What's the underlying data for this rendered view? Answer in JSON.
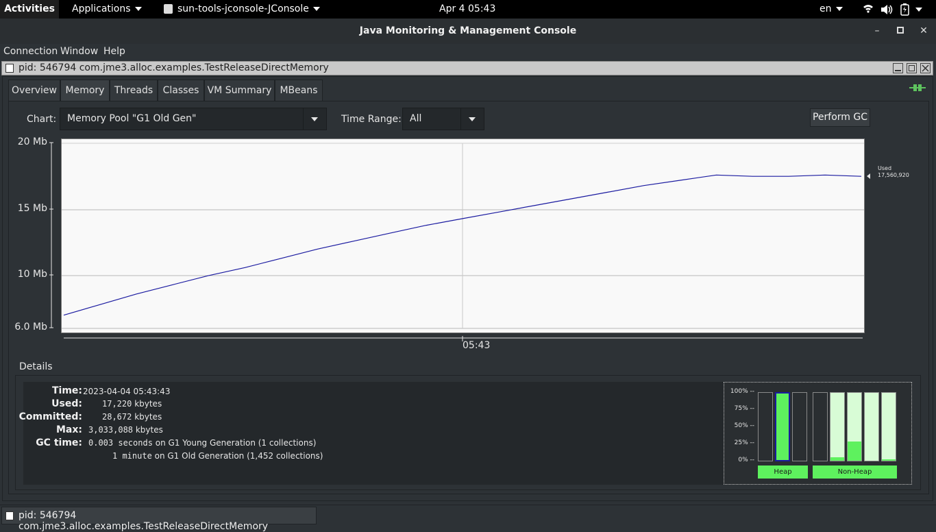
{
  "topbar": {
    "activities": "Activities",
    "applications": "Applications",
    "app_name": "sun-tools-jconsole-JConsole",
    "clock": "Apr 4  05:43",
    "lang": "en"
  },
  "window": {
    "title": "Java Monitoring & Management Console",
    "minimize": "–",
    "maximize": "▫",
    "close": "✕"
  },
  "menu": {
    "connection": "Connection",
    "window": "Window",
    "help": "Help"
  },
  "frame": {
    "title": "pid: 546794 com.jme3.alloc.examples.TestReleaseDirectMemory"
  },
  "tabs": [
    {
      "label": "Overview"
    },
    {
      "label": "Memory"
    },
    {
      "label": "Threads"
    },
    {
      "label": "Classes"
    },
    {
      "label": "VM Summary"
    },
    {
      "label": "MBeans"
    }
  ],
  "controls": {
    "chart_label": "Chart:",
    "chart_value": "Memory Pool \"G1 Old Gen\"",
    "time_range_label": "Time Range:",
    "time_range_value": "All",
    "perform_gc": "Perform GC"
  },
  "chart_data": {
    "type": "line",
    "y_ticks": [
      "20 Mb",
      "15 Mb",
      "10 Mb",
      "6.0 Mb"
    ],
    "x_ticks": [
      "05:43"
    ],
    "ylim": [
      6.0,
      20
    ],
    "grid": true,
    "series": [
      {
        "name": "Used",
        "color": "#1a1aa0",
        "x": [
          0,
          1,
          2,
          3,
          4,
          5,
          6,
          7,
          8,
          9,
          10,
          11,
          12,
          13,
          14,
          15,
          16,
          17,
          18,
          19,
          20,
          21,
          22
        ],
        "y": [
          7.0,
          7.8,
          8.6,
          9.3,
          10.0,
          10.6,
          11.3,
          12.0,
          12.6,
          13.2,
          13.8,
          14.3,
          14.8,
          15.3,
          15.8,
          16.3,
          16.8,
          17.2,
          17.6,
          17.5,
          17.5,
          17.6,
          17.5
        ]
      }
    ],
    "end_label": "Used",
    "end_value": "17,560,920"
  },
  "details": {
    "legend": "Details",
    "time_label": "Time:",
    "time_value": "2023-04-04 05:43:43",
    "used_label": "Used:",
    "used_value": "17,220",
    "used_unit": "kbytes",
    "committed_label": "Committed:",
    "committed_value": "28,672",
    "committed_unit": "kbytes",
    "max_label": "Max:",
    "max_value": "3,033,088",
    "max_unit": "kbytes",
    "gc_label": "GC time:",
    "gc1_value": "0.003 seconds",
    "gc1_desc": "on G1 Young Generation (1 collections)",
    "gc2_value": "1 minute",
    "gc2_desc": "on G1 Old Generation (1,452 collections)"
  },
  "bars": {
    "pct_labels": [
      "100% --",
      "75% --",
      "50% --",
      "25% --",
      "0% --"
    ],
    "heap_label": "Heap",
    "nonheap_label": "Non-Heap",
    "heap_levels": [
      0.0,
      1.0,
      0.0
    ],
    "heap_selected": 1,
    "nonheap_levels": [
      0.0,
      0.05,
      0.28,
      0.0,
      0.02
    ],
    "fill_color": "#5ef15e",
    "committed_color": "#d8fcd6"
  },
  "taskbar": {
    "item": "pid: 546794 com.jme3.alloc.examples.TestReleaseDirectMemory"
  }
}
